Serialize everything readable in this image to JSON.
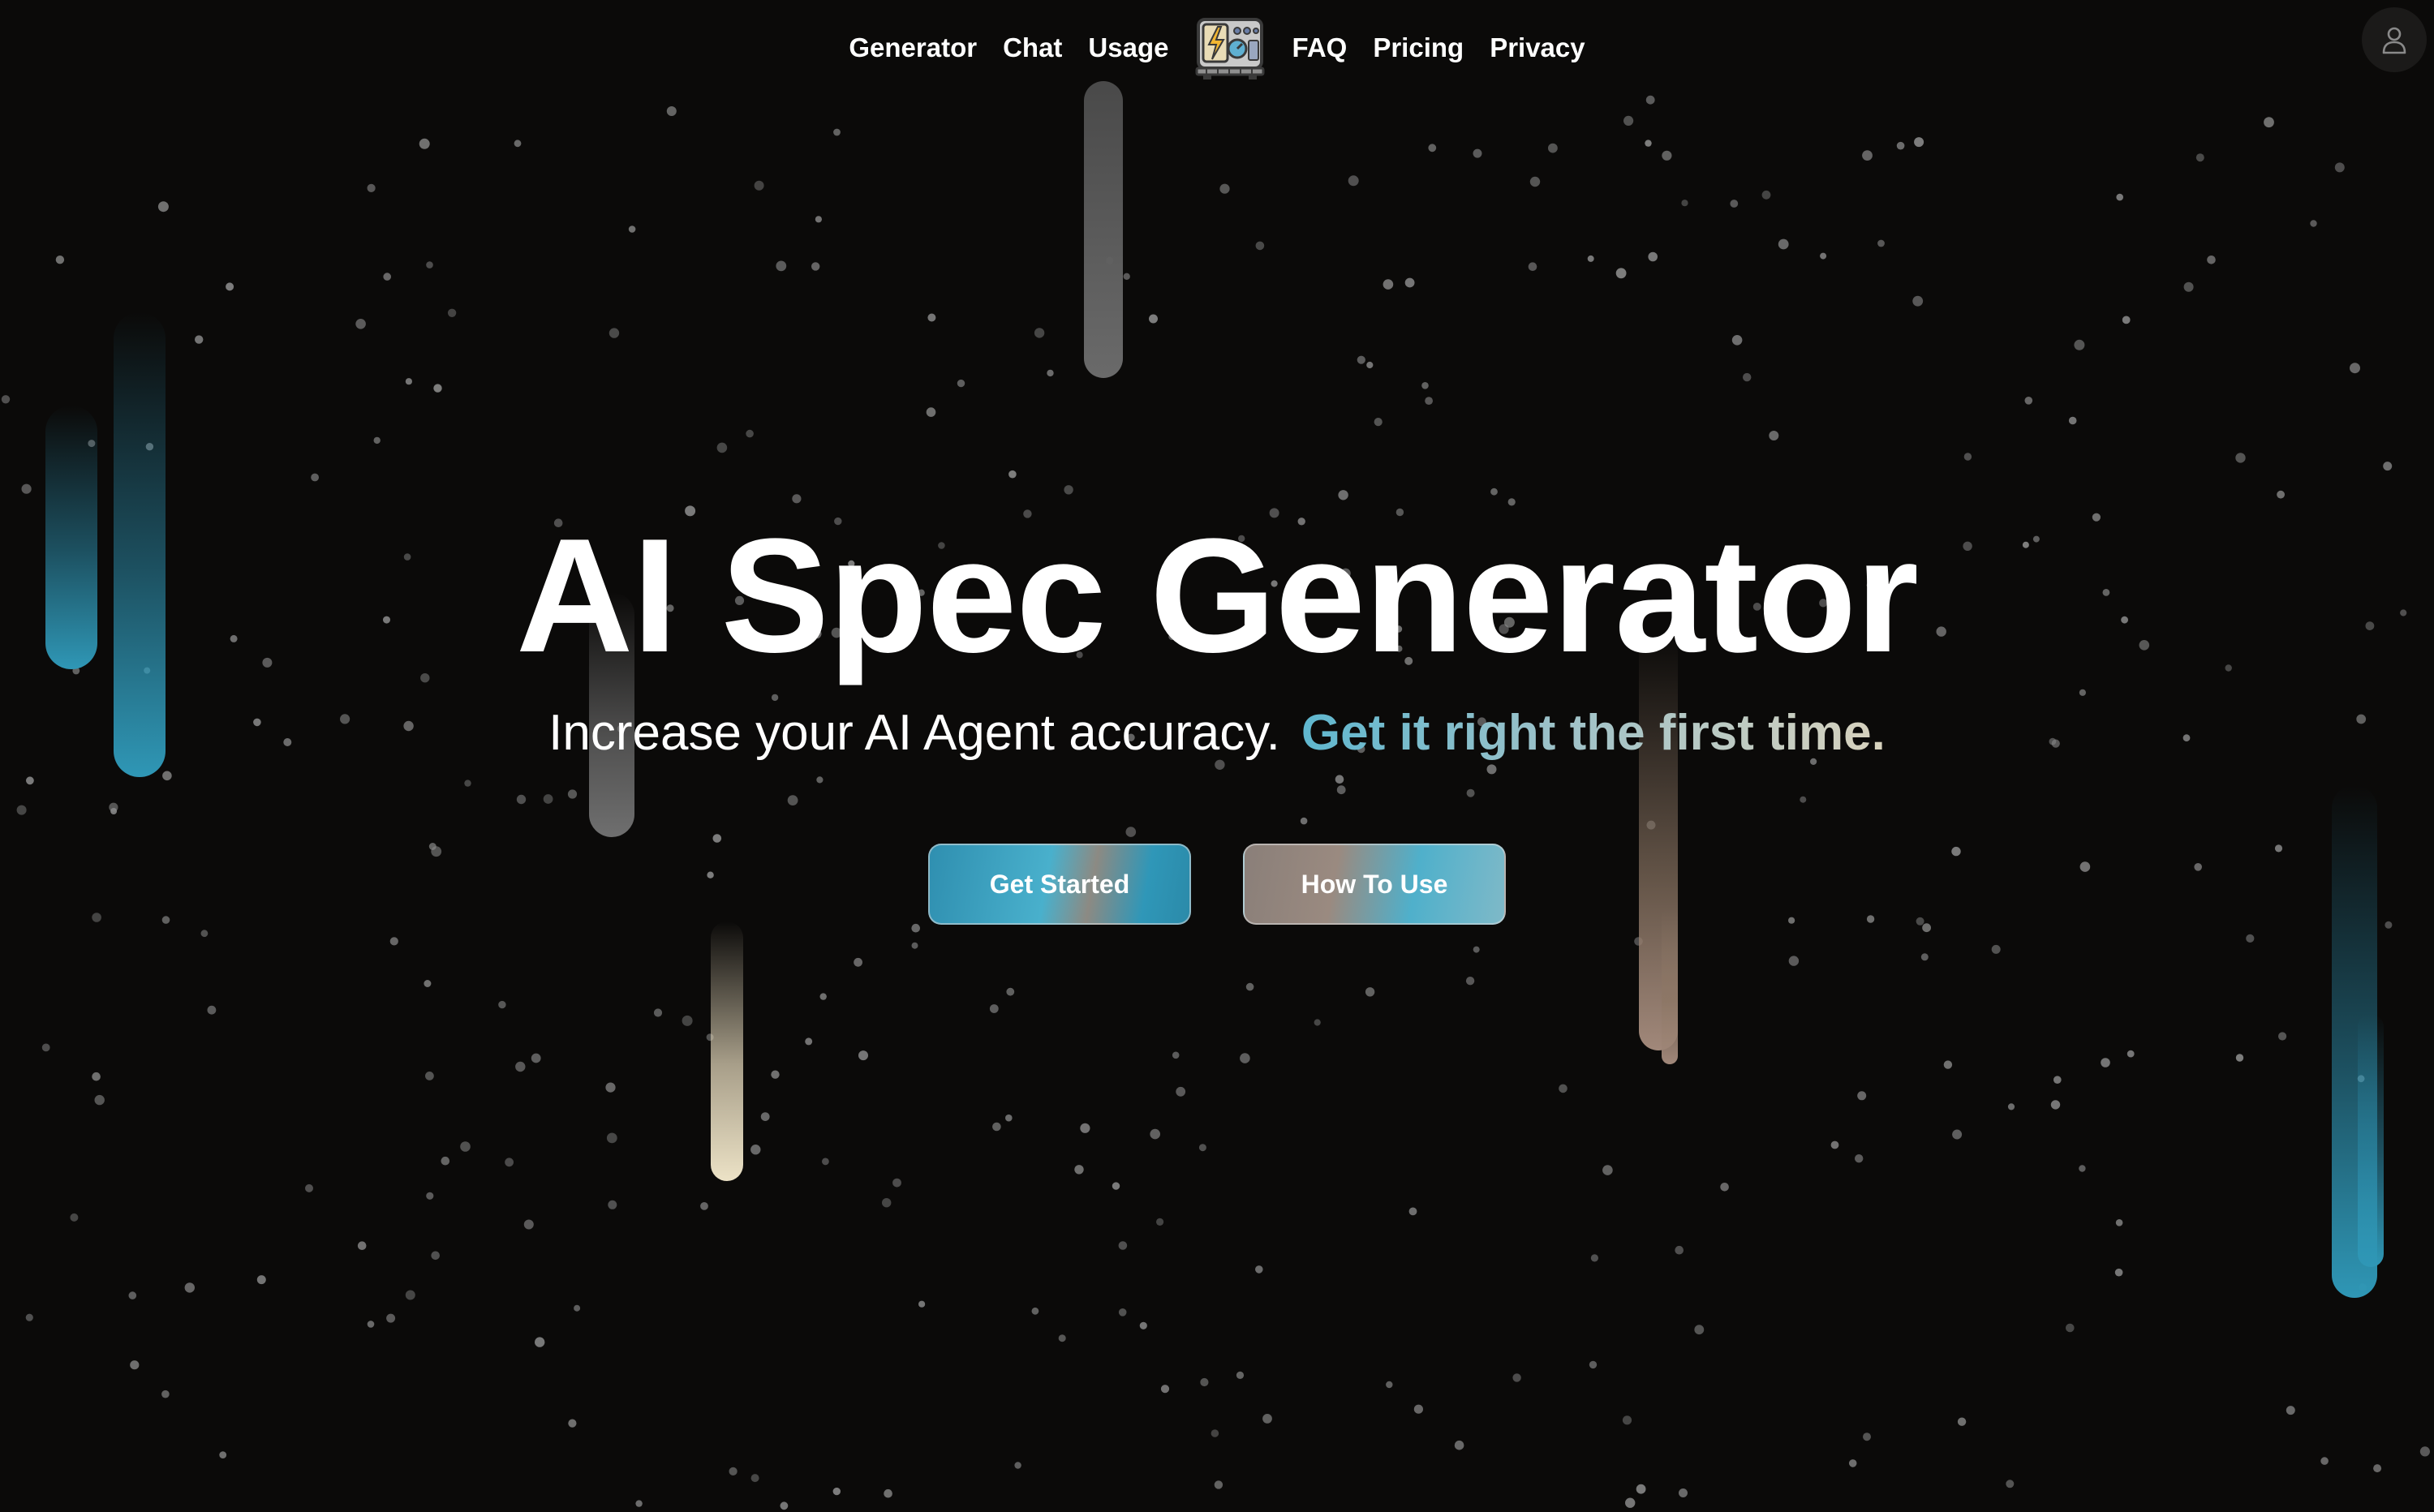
{
  "nav": {
    "links_left": [
      {
        "label": "Generator"
      },
      {
        "label": "Chat"
      },
      {
        "label": "Usage"
      }
    ],
    "links_right": [
      {
        "label": "FAQ"
      },
      {
        "label": "Pricing"
      },
      {
        "label": "Privacy"
      }
    ],
    "logo_icon": "generator-machine-icon",
    "account_icon": "user-icon"
  },
  "hero": {
    "title": "AI Spec Generator",
    "subtitle": "Increase your AI Agent accuracy.",
    "subtitle_accent": "Get it right the first time.",
    "primary_button": "Get Started",
    "secondary_button": "How To Use"
  },
  "colors": {
    "background": "#0b0a09",
    "accent_blue": "#2f97b6",
    "accent_tan": "#a1887a",
    "accent_cream": "#ece2c6"
  }
}
